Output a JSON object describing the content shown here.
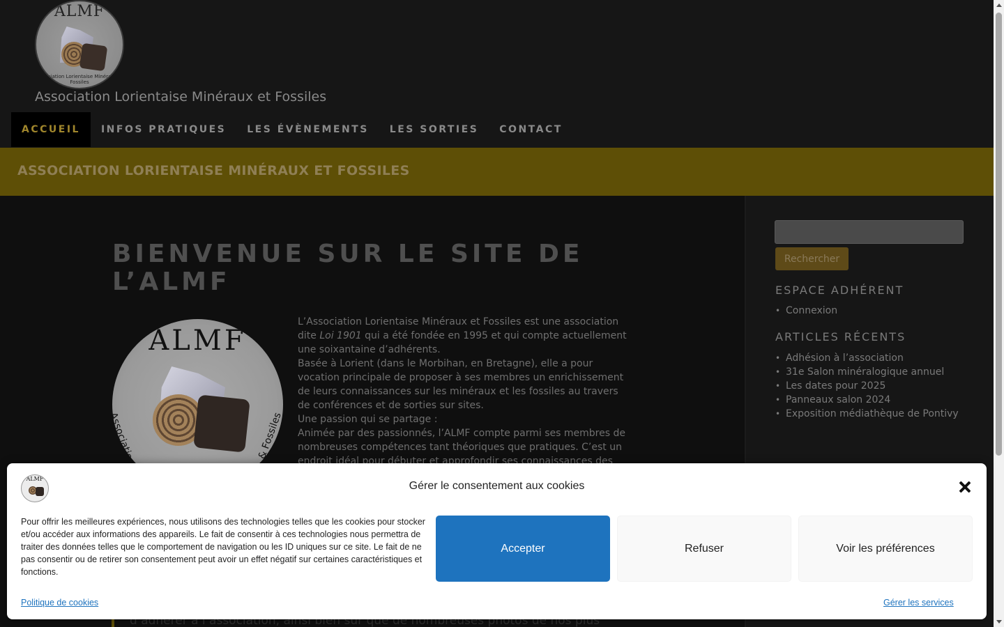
{
  "site": {
    "logo_text": "ALMF",
    "logo_ring_text": "Association Lorientaise Minéraux & Fossiles",
    "title": "Association Lorientaise Minéraux et Fossiles"
  },
  "nav": {
    "items": [
      {
        "label": "ACCUEIL",
        "active": true
      },
      {
        "label": "INFOS PRATIQUES",
        "active": false
      },
      {
        "label": "LES ÉVÈNEMENTS",
        "active": false
      },
      {
        "label": "LES SORTIES",
        "active": false
      },
      {
        "label": "CONTACT",
        "active": false
      }
    ]
  },
  "banner": {
    "title": "ASSOCIATION LORIENTAISE MINÉRAUX ET FOSSILES"
  },
  "article": {
    "title": "BIENVENUE SUR LE SITE DE L’ALMF",
    "logo_text": "ALMF",
    "logo_ring_left": "Association",
    "logo_ring_right": "& Fossiles",
    "p1_before": "L’Association Lorientaise Minéraux et Fossiles est une association dite ",
    "p1_em": "Loi 1901",
    "p1_after": " qui a été fondée en 1995 et qui compte actuellement une soixantaine d’adhérents.",
    "p2": "Basée à Lorient (dans le Morbihan, en Bretagne), elle a pour vocation principale de proposer à ses membres un enrichissement de leurs connaissances sur les minéraux et les fossiles au travers de conférences et de sorties sur sites.",
    "p3": "Une passion qui se partage :",
    "p4": "Animée par des passionnés, l’ALMF compte parmi ses membres de nombreuses compétences tant théoriques que pratiques. C’est un endroit idéal pour débuter et approfondir ses connaissances des",
    "quote_partial": "d’adhérer à l’association, ainsi bien sûr que de nombreuses photos de nos plus"
  },
  "sidebar": {
    "search_button": "Rechercher",
    "search_placeholder": "",
    "member_title": "ESPACE ADHÉRENT",
    "member_links": [
      "Connexion"
    ],
    "recent_title": "ARTICLES RÉCENTS",
    "recent_links": [
      "Adhésion à l’association",
      "31e Salon minéralogique annuel",
      "Les dates pour 2025",
      "Panneaux salon 2024",
      "Exposition médiathèque de Pontivy"
    ]
  },
  "cookie": {
    "logo_text": "ALMF",
    "title": "Gérer le consentement aux cookies",
    "text": "Pour offrir les meilleures expériences, nous utilisons des technologies telles que les cookies pour stocker et/ou accéder aux informations des appareils. Le fait de consentir à ces technologies nous permettra de traiter des données telles que le comportement de navigation ou les ID uniques sur ce site. Le fait de ne pas consentir ou de retirer son consentement peut avoir un effet négatif sur certaines caractéristiques et fonctions.",
    "accept": "Accepter",
    "refuse": "Refuser",
    "preferences": "Voir les préférences",
    "policy_link": "Politique de cookies",
    "services_link": "Gérer les services"
  },
  "colors": {
    "banner": "#5e4f06",
    "active_nav": "#a0862c",
    "accept_button": "#1e73be"
  }
}
